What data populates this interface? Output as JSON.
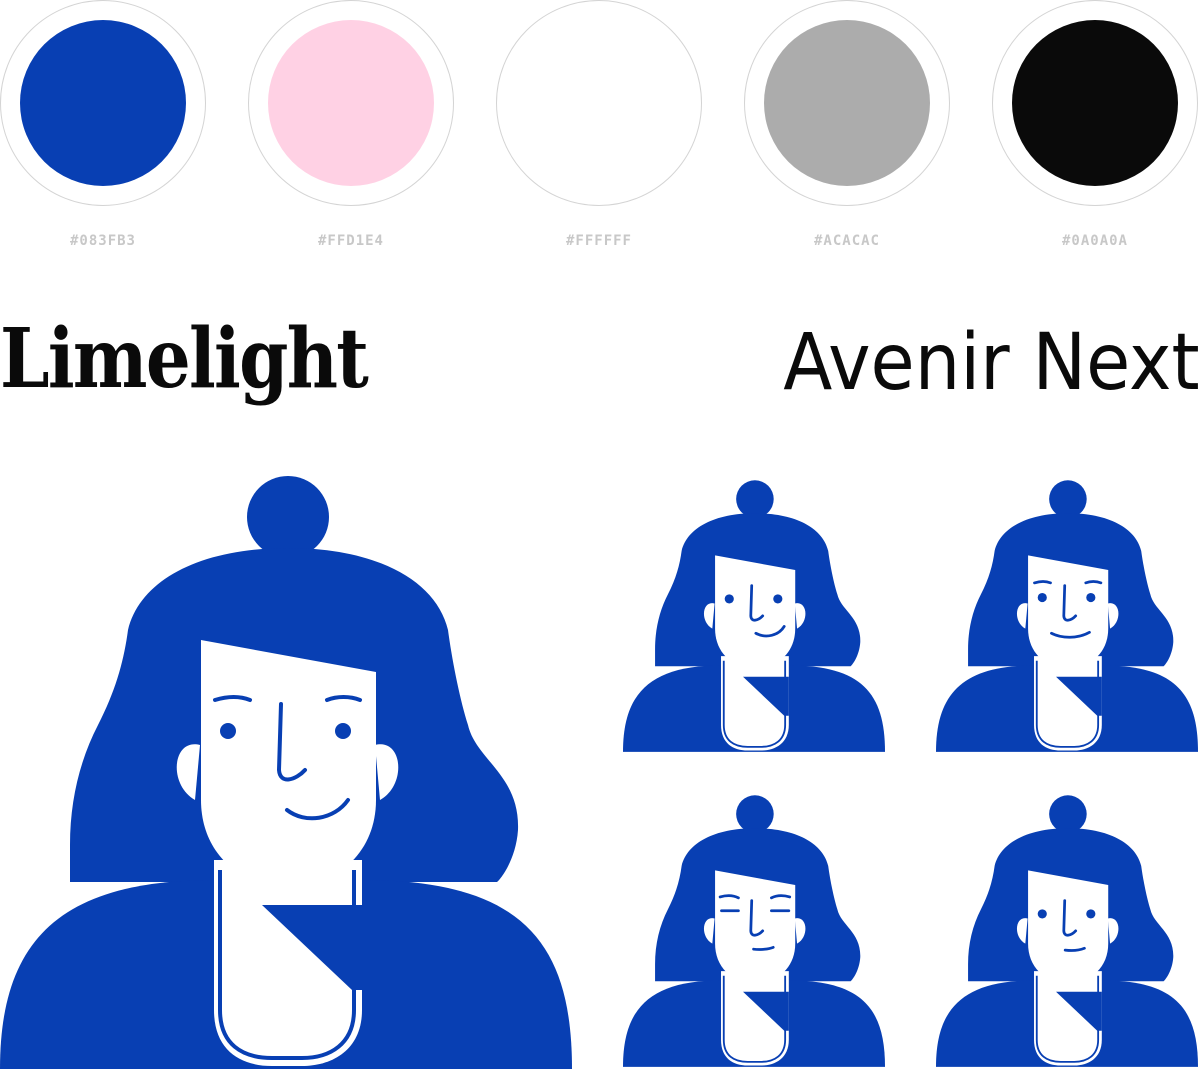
{
  "palette": {
    "swatches": [
      {
        "hex": "#083FB3",
        "label": "#083FB3"
      },
      {
        "hex": "#FFD1E4",
        "label": "#FFD1E4"
      },
      {
        "hex": "#FFFFFF",
        "label": "#FFFFFF"
      },
      {
        "hex": "#ACACAC",
        "label": "#ACACAC"
      },
      {
        "hex": "#0A0A0A",
        "label": "#0A0A0A"
      }
    ]
  },
  "typography": {
    "display_font": "Limelight",
    "body_font": "Avenir Next"
  },
  "avatar": {
    "color": "#083FB3",
    "expressions": [
      "smile-brows",
      "smirk",
      "smile",
      "closed-eyes",
      "neutral"
    ]
  }
}
